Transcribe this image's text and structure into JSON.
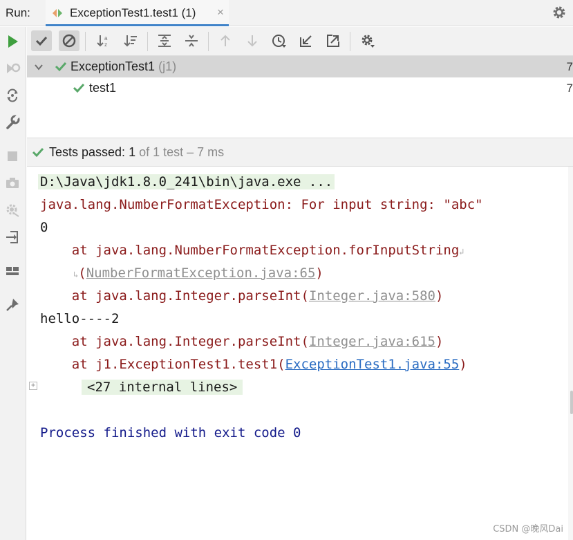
{
  "header": {
    "run_label": "Run:",
    "tab_title": "ExceptionTest1.test1 (1)",
    "tab_close": "×"
  },
  "icons": {
    "header": [
      "junit-run-icon",
      "close-icon",
      "gear-icon"
    ],
    "sidebar": [
      "run-icon",
      "rerun-failed-icon",
      "toggle-auto-test-icon",
      "wrench-icon",
      "stop-icon",
      "camera-icon",
      "settings-gear-icon",
      "exit-icon",
      "layout-icon",
      "pin-icon"
    ],
    "toolbar": [
      "show-passed-icon",
      "show-ignored-icon",
      "sort-alpha-icon",
      "sort-duration-icon",
      "expand-all-icon",
      "collapse-all-icon",
      "prev-failed-icon",
      "next-failed-icon",
      "history-icon",
      "import-tests-icon",
      "export-tests-icon",
      "gear-icon"
    ]
  },
  "tree": {
    "root": {
      "name": "ExceptionTest1",
      "package": "(j1)",
      "edge": "7"
    },
    "child": {
      "name": "test1",
      "edge": "7"
    }
  },
  "status": {
    "label": "Tests passed:",
    "count": "1",
    "rest": "of 1 test – 7 ms"
  },
  "console": {
    "cmd": "D:\\Java\\jdk1.8.0_241\\bin\\java.exe ...",
    "exception": "java.lang.NumberFormatException: For input string: \"abc\"",
    "zero": "0",
    "at1_prefix": "    at java.lang.NumberFormatException.forInputString",
    "at1_cont_open": "(",
    "at1_link": "NumberFormatException.java:65",
    "at1_close": ")",
    "at2_prefix": "    at java.lang.Integer.parseInt(",
    "at2_link": "Integer.java:580",
    "at2_close": ")",
    "hello": "hello----2",
    "at3_prefix": "    at java.lang.Integer.parseInt(",
    "at3_link": "Integer.java:615",
    "at3_close": ")",
    "at4_prefix": "    at j1.ExceptionTest1.test1(",
    "at4_link": "ExceptionTest1.java:55",
    "at4_close": ")",
    "folded": "<27 internal lines>",
    "finished": "Process finished with exit code 0"
  },
  "watermark": "CSDN @晚风Dai",
  "colors": {
    "accent_tab": "#4083c9",
    "pass_green": "#59a869",
    "run_green": "#3f9f3f",
    "error_red": "#8a1a1a",
    "exit_navy": "#131a8a",
    "link_blue": "#2a6cc2"
  }
}
